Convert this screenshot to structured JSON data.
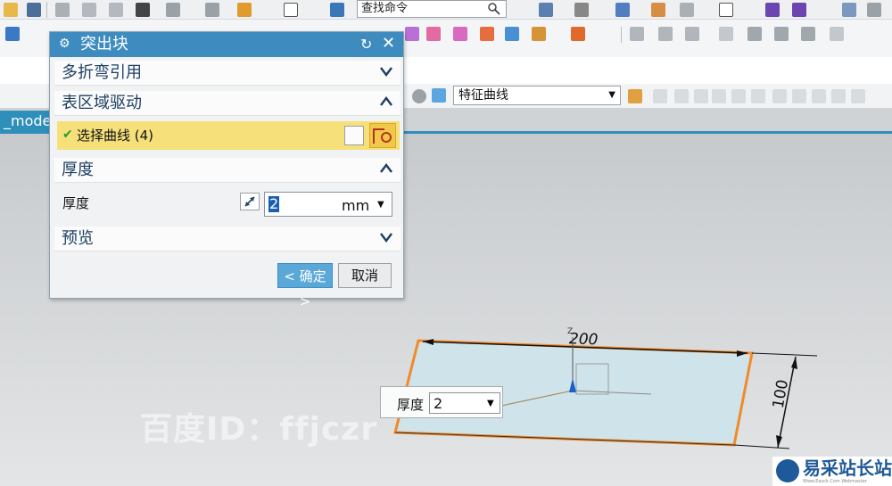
{
  "toolbar": {
    "command_search_value": "查找命令",
    "curve_rule_value": "特征曲线"
  },
  "model_tab": {
    "label": "_mode"
  },
  "dialog": {
    "title": "突出块",
    "sections": {
      "bend_ref": {
        "label": "多折弯引用"
      },
      "surface_region": {
        "label": "表区域驱动"
      },
      "thickness": {
        "label": "厚度"
      },
      "preview": {
        "label": "预览"
      }
    },
    "select_curve_label": "选择曲线 (4)",
    "thickness_field_label": "厚度",
    "thickness_value": "2",
    "thickness_unit": "mm",
    "ok_label": "< 确定 >",
    "cancel_label": "取消"
  },
  "viewport": {
    "dim_length": "200",
    "dim_width": "100",
    "float_label": "厚度",
    "float_value": "2"
  },
  "watermarks": {
    "baidu": "百度ID：ffjczr",
    "brand": "易采站长站",
    "brand_sub": "Www.Easck.Com Webmaster"
  },
  "colors": {
    "title_bar": "#3e8cbf",
    "selected_row": "#f6e07a",
    "plate_fill": "#cfe4ea",
    "plate_edge": "#f08a2a"
  }
}
